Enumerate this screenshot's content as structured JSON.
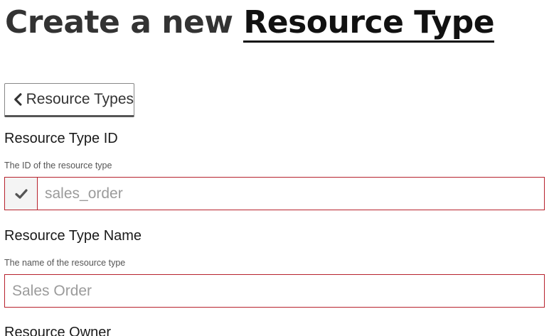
{
  "header": {
    "title_prefix": "Create a new",
    "title_highlight": "Resource Type"
  },
  "back_button": {
    "label": "Resource Types",
    "icon": "chevron-left-icon"
  },
  "fields": {
    "resource_type_id": {
      "label": "Resource Type ID",
      "help": "The ID of the resource type",
      "placeholder": "sales_order",
      "value": "",
      "addon_icon": "check-icon"
    },
    "resource_type_name": {
      "label": "Resource Type Name",
      "help": "The name of the resource type",
      "placeholder": "Sales Order",
      "value": ""
    },
    "resource_owner": {
      "label": "Resource Owner"
    }
  },
  "colors": {
    "invalid_border": "#b7222d",
    "title_text": "#333333",
    "placeholder_text": "#9b9b9b"
  }
}
